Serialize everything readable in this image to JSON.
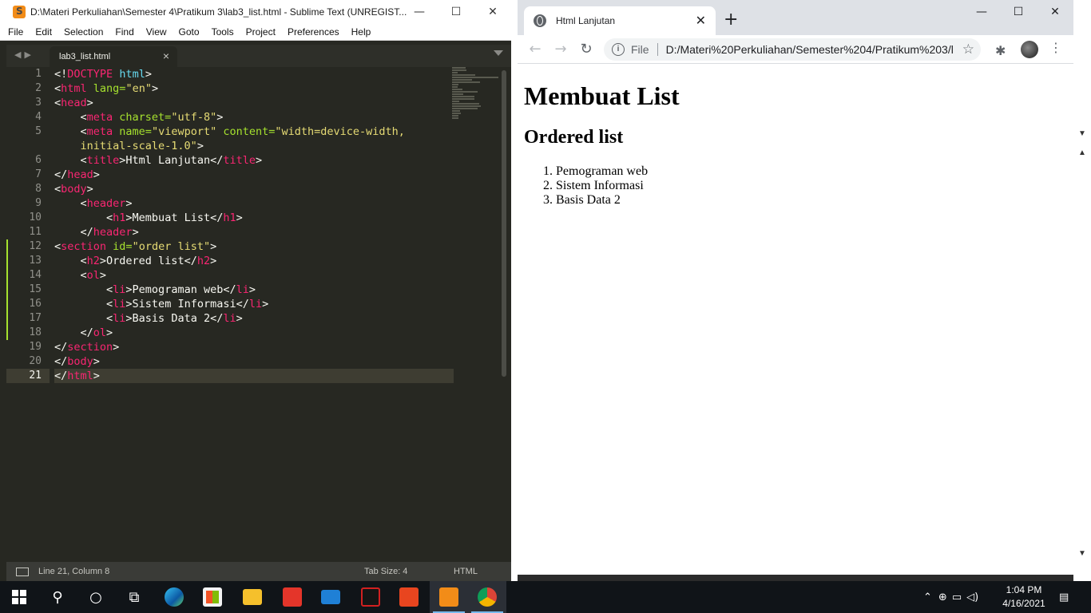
{
  "sublime": {
    "title": "D:\\Materi Perkuliahan\\Semester 4\\Pratikum 3\\lab3_list.html - Sublime Text (UNREGIST...",
    "menu": [
      "File",
      "Edit",
      "Selection",
      "Find",
      "View",
      "Goto",
      "Tools",
      "Project",
      "Preferences",
      "Help"
    ],
    "tab_label": "lab3_list.html",
    "line_numbers": [
      "1",
      "2",
      "3",
      "4",
      "5",
      "",
      "6",
      "7",
      "8",
      "9",
      "10",
      "11",
      "12",
      "13",
      "14",
      "15",
      "16",
      "17",
      "18",
      "19",
      "20",
      "21"
    ],
    "status": {
      "position": "Line 21, Column 8",
      "tab_size": "Tab Size: 4",
      "syntax": "HTML"
    }
  },
  "chrome": {
    "tab_title": "Html Lanjutan",
    "url_scheme": "File",
    "url": "D:/Materi%20Perkuliahan/Semester%204/Pratikum%203/l...",
    "page": {
      "h1": "Membuat List",
      "h2": "Ordered list",
      "items": [
        "Pemograman web",
        "Sistem Informasi",
        "Basis Data 2"
      ]
    }
  },
  "taskbar": {
    "time": "1:04 PM",
    "date": "4/16/2021"
  },
  "icons": {
    "start": "windows-logo-icon",
    "search": "search-icon",
    "cortana": "cortana-icon",
    "taskview": "task-view-icon",
    "edge": "edge-icon",
    "store": "store-icon",
    "explorer": "file-explorer-icon",
    "gift": "gift-app-icon",
    "mail": "mail-icon",
    "game": "game-app-icon",
    "pdf": "pdf-app-icon",
    "sublime": "sublime-text-icon",
    "chrome": "chrome-icon"
  },
  "colors": {
    "editor_bg": "#272822",
    "tag": "#f92672",
    "attr": "#a6e22e",
    "string": "#e6db74",
    "taskbar_bg": "#101418"
  }
}
